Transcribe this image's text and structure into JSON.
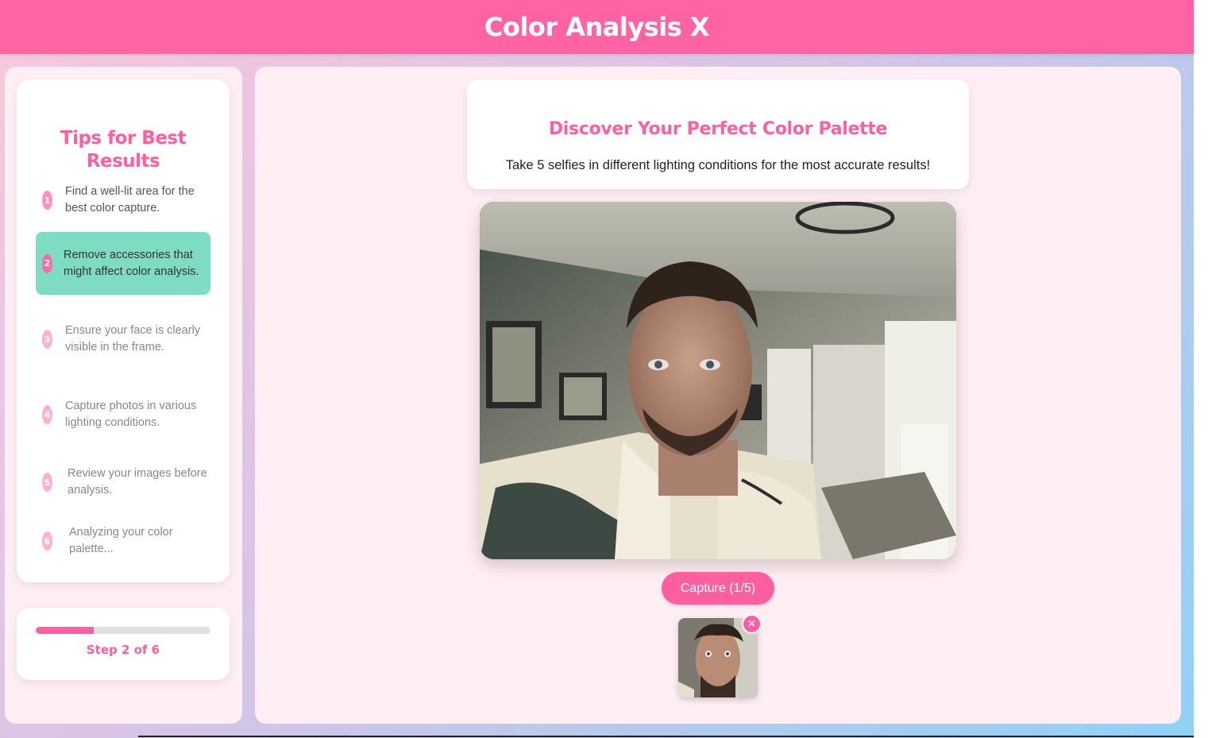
{
  "header": {
    "title": "Color Analysis X"
  },
  "sidebar": {
    "title": "Tips for Best Results",
    "tips": [
      {
        "num": "1",
        "text": "Find a well-lit area for the best color capture.",
        "state": "done"
      },
      {
        "num": "2",
        "text": "Remove accessories that might affect color analysis.",
        "state": "active"
      },
      {
        "num": "3",
        "text": "Ensure your face is clearly visible in the frame.",
        "state": "pending"
      },
      {
        "num": "4",
        "text": "Capture photos in various lighting conditions.",
        "state": "pending"
      },
      {
        "num": "5",
        "text": "Review your images before analysis.",
        "state": "pending"
      },
      {
        "num": "6",
        "text": "Analyzing your color palette...",
        "state": "pending"
      }
    ],
    "progress": {
      "label": "Step 2 of 6",
      "fraction": 0.333
    }
  },
  "main": {
    "title": "Discover Your Perfect Color Palette",
    "subtitle": "Take 5 selfies in different lighting conditions for the most accurate results!",
    "capture_label": "Capture (1/5)",
    "thumbnail_remove": "×"
  },
  "colors": {
    "accent": "#ff5ea0",
    "header": "#ff63a4",
    "active_tip": "#7ddcc3",
    "panel": "#ffeef3"
  }
}
